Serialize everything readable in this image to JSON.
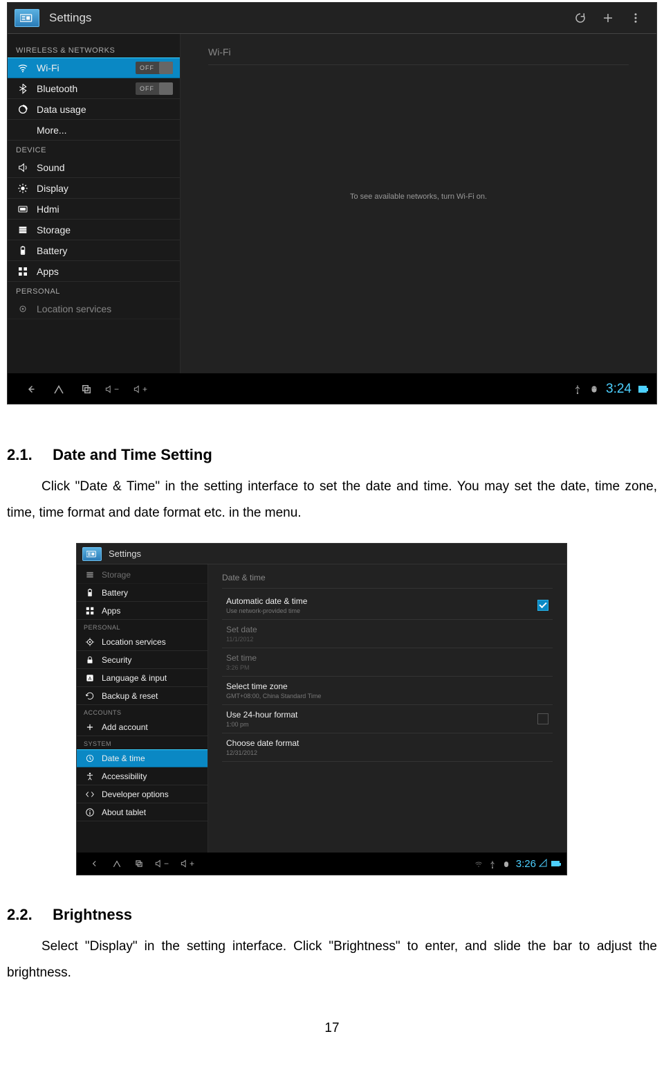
{
  "screenshot1": {
    "app_title": "Settings",
    "left": {
      "cat_wireless": "WIRELESS & NETWORKS",
      "wifi": "Wi-Fi",
      "wifi_toggle": "OFF",
      "bluetooth": "Bluetooth",
      "bluetooth_toggle": "OFF",
      "data_usage": "Data usage",
      "more": "More...",
      "cat_device": "DEVICE",
      "sound": "Sound",
      "display": "Display",
      "hdmi": "Hdmi",
      "storage": "Storage",
      "battery": "Battery",
      "apps": "Apps",
      "cat_personal": "PERSONAL",
      "location": "Location services"
    },
    "right": {
      "title": "Wi-Fi",
      "message": "To see available networks, turn Wi-Fi on."
    },
    "navbar": {
      "vol_down": "−",
      "vol_up": "+",
      "clock": "3:24"
    }
  },
  "doc1": {
    "num": "2.1.",
    "title": "Date and Time Setting",
    "para": "Click \"Date & Time\" in the setting interface to set the date and time. You may set the date, time zone, time, time format and date format etc. in the menu."
  },
  "screenshot2": {
    "app_title": "Settings",
    "left": {
      "storage": "Storage",
      "battery": "Battery",
      "apps": "Apps",
      "cat_personal": "PERSONAL",
      "location": "Location services",
      "security": "Security",
      "language": "Language & input",
      "backup": "Backup & reset",
      "cat_accounts": "ACCOUNTS",
      "add_account": "Add account",
      "cat_system": "SYSTEM",
      "datetime": "Date & time",
      "accessibility": "Accessibility",
      "developer": "Developer options",
      "about": "About tablet"
    },
    "right": {
      "title": "Date & time",
      "auto": {
        "l1": "Automatic date & time",
        "l2": "Use network-provided time"
      },
      "setdate": {
        "l1": "Set date",
        "l2": "11/1/2012"
      },
      "settime": {
        "l1": "Set time",
        "l2": "3:26 PM"
      },
      "tz": {
        "l1": "Select time zone",
        "l2": "GMT+08:00, China Standard Time"
      },
      "fmt24": {
        "l1": "Use 24-hour format",
        "l2": "1:00 pm"
      },
      "datefmt": {
        "l1": "Choose date format",
        "l2": "12/31/2012"
      }
    },
    "navbar": {
      "vol_down": "−",
      "vol_up": "+",
      "clock": "3:26"
    }
  },
  "doc2": {
    "num": "2.2.",
    "title": "Brightness",
    "para": "Select \"Display\" in the setting interface. Click \"Brightness\" to enter, and slide the bar to adjust the brightness."
  },
  "page_number": "17"
}
